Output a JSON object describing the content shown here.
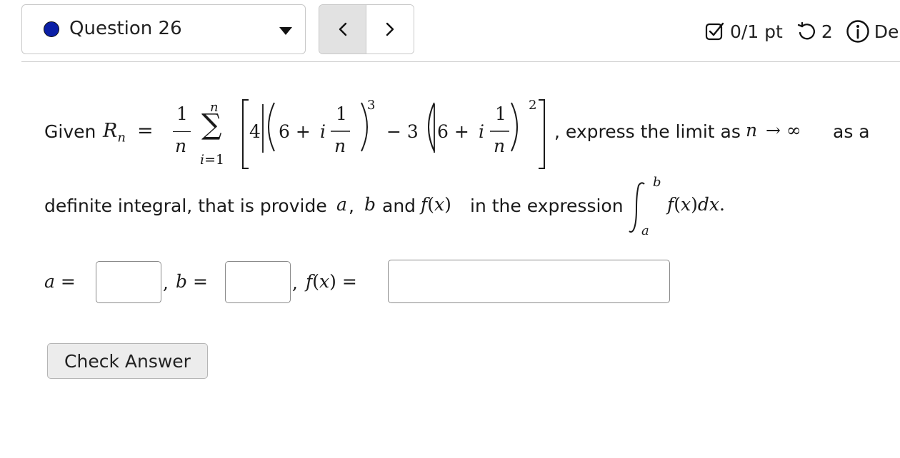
{
  "header": {
    "question_label": "Question 26",
    "points": "0/1 pt",
    "retries": "2",
    "details_label": "De"
  },
  "question": {
    "given": "Given",
    "express": ", express the limit as",
    "as_a": "as a",
    "line2": "definite integral, that is provide",
    "and": "and",
    "in_expr": "in the expression",
    "comma": ","
  },
  "answers": {
    "a_label": "a =",
    "b_label": "b =",
    "f_label": "f(x) =",
    "a_value": "",
    "b_value": "",
    "f_value": ""
  },
  "actions": {
    "check_answer": "Check Answer"
  },
  "colors": {
    "dot": "#0b1fa6",
    "nav_prev_bg": "#e2e2e2",
    "button_bg": "#ececec"
  }
}
